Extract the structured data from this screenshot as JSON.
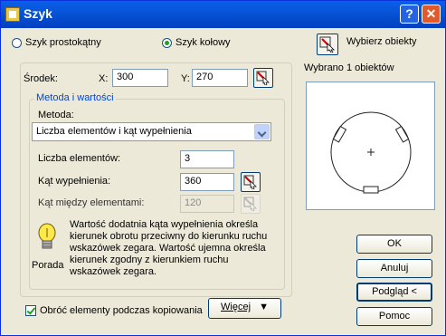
{
  "window": {
    "title": "Szyk",
    "help_label": "?",
    "close_label": "✕"
  },
  "array_type": {
    "rectangular_label": "Szyk prostokątny",
    "polar_label": "Szyk kołowy",
    "selected": "polar"
  },
  "center": {
    "label": "Środek:",
    "x_label": "X:",
    "x_value": "300",
    "y_label": "Y:",
    "y_value": "270"
  },
  "method_group": {
    "title": "Metoda i wartości",
    "method_label": "Metoda:",
    "method_value": "Liczba elementów i kąt wypełnienia",
    "items_label": "Liczba elementów:",
    "items_value": "3",
    "fill_angle_label": "Kąt wypełnienia:",
    "fill_angle_value": "360",
    "between_label": "Kąt między elementami:",
    "between_value": "120"
  },
  "tip": {
    "text": "Wartość dodatnia kąta wypełnienia określa kierunek obrotu przeciwny do kierunku ruchu wskazówek zegara. Wartość ujemna określa kierunek zgodny z kierunkiem ruchu wskazówek zegara.",
    "caption": "Porada"
  },
  "rotate": {
    "label": "Obróć elementy podczas kopiowania",
    "checked": true
  },
  "more_button": {
    "label": "Więcej",
    "icon": "double-chevron-down-icon"
  },
  "select_objects": {
    "label": "Wybierz obiekty",
    "status": "Wybrano 1 obiektów"
  },
  "buttons": {
    "ok": "OK",
    "cancel": "Anuluj",
    "preview": "Podgląd <",
    "help": "Pomoc"
  }
}
